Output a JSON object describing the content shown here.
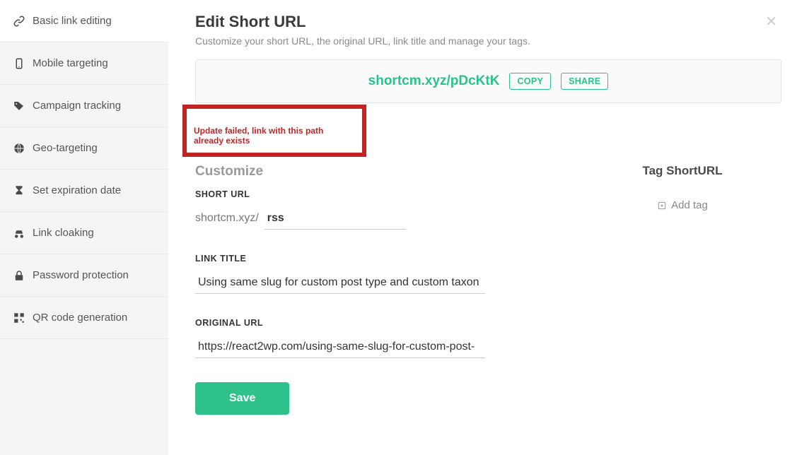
{
  "sidebar": {
    "items": [
      {
        "label": "Basic link editing"
      },
      {
        "label": "Mobile targeting"
      },
      {
        "label": "Campaign tracking"
      },
      {
        "label": "Geo-targeting"
      },
      {
        "label": "Set expiration date"
      },
      {
        "label": "Link cloaking"
      },
      {
        "label": "Password protection"
      },
      {
        "label": "QR code generation"
      }
    ]
  },
  "main": {
    "title": "Edit Short URL",
    "subtitle": "Customize your short URL, the original URL, link title and manage your tags.",
    "short_url_display": "shortcm.xyz/pDcKtK",
    "copy_label": "COPY",
    "share_label": "SHARE",
    "error_message": "Update failed, link with this path already exists",
    "customize_heading": "Customize",
    "fields": {
      "short_url_label": "SHORT URL",
      "domain_prefix": "shortcm.xyz/",
      "slug_value": "rss",
      "link_title_label": "LINK TITLE",
      "link_title_value": "Using same slug for custom post type and custom taxon",
      "original_url_label": "ORIGINAL URL",
      "original_url_value": "https://react2wp.com/using-same-slug-for-custom-post-"
    },
    "save_label": "Save"
  },
  "right": {
    "heading": "Tag ShortURL",
    "add_tag_label": "Add tag"
  }
}
